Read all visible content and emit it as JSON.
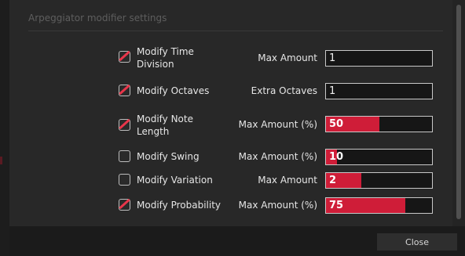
{
  "dialog": {
    "section_title": "Arpeggiator modifier settings",
    "rows": [
      {
        "checked": true,
        "label": "Modify Time Division",
        "amount_label": "Max Amount",
        "value": "1",
        "level": null
      },
      {
        "checked": true,
        "label": "Modify Octaves",
        "amount_label": "Extra Octaves",
        "value": "1",
        "level": null
      },
      {
        "checked": true,
        "label": "Modify Note Length",
        "amount_label": "Max Amount (%)",
        "value": "50",
        "level": 0.5
      },
      {
        "checked": false,
        "label": "Modify Swing",
        "amount_label": "Max Amount (%)",
        "value": "10",
        "level": 0.1
      },
      {
        "checked": false,
        "label": "Modify Variation",
        "amount_label": "Max Amount",
        "value": "2",
        "level": 0.33
      },
      {
        "checked": true,
        "label": "Modify Probability",
        "amount_label": "Max Amount (%)",
        "value": "75",
        "level": 0.75
      }
    ],
    "close_label": "Close"
  },
  "colors": {
    "accent": "#cf1d38",
    "checkmark": "#e8364a",
    "background": "#282828"
  }
}
